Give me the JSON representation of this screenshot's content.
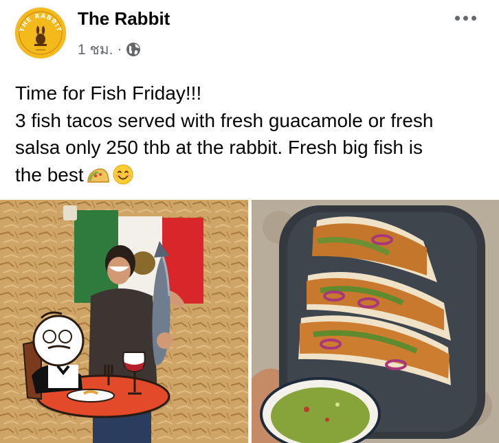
{
  "post": {
    "page_name": "The Rabbit",
    "timestamp": "1 ชม.",
    "separator": "·",
    "audience_icon": "globe-icon",
    "more_icon": "more-options-icon",
    "text_lines": [
      "Time for Fish Friday!!!",
      "3 fish tacos served with fresh guacamole or fresh",
      "salsa only 250 thb at the rabbit. Fresh big fish is",
      "the best"
    ],
    "emojis": [
      "taco-emoji",
      "smiling-face-emoji"
    ]
  },
  "avatar": {
    "logo_text": "THE RABBIT",
    "bg_color": "#f4b91a"
  },
  "photos": [
    {
      "name": "photo-woman-holding-fish",
      "overlay_icon": "restaurant-waiter-icon"
    },
    {
      "name": "photo-fish-tacos"
    }
  ],
  "colors": {
    "text": "#050505",
    "secondary_text": "#65676b"
  }
}
